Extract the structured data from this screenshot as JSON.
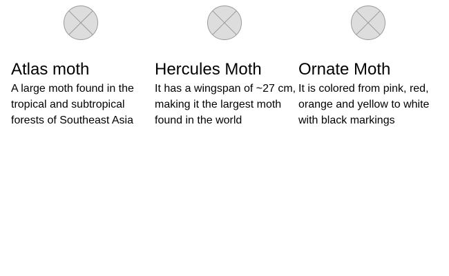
{
  "cards": [
    {
      "icon": "placeholder-image-icon",
      "title": "Atlas moth",
      "description": "A large moth found in the tropical and subtropical forests of Southeast Asia"
    },
    {
      "icon": "placeholder-image-icon",
      "title": "Hercules Moth",
      "description": "It has a wingspan of ~27 cm, making it the largest moth found in the world"
    },
    {
      "icon": "placeholder-image-icon",
      "title": "Ornate Moth",
      "description": "It is colored from pink, red, orange and yellow to white with black markings"
    }
  ],
  "colors": {
    "placeholder_fill": "#dddddd",
    "placeholder_stroke": "#999999",
    "text": "#000000",
    "background": "#ffffff"
  }
}
